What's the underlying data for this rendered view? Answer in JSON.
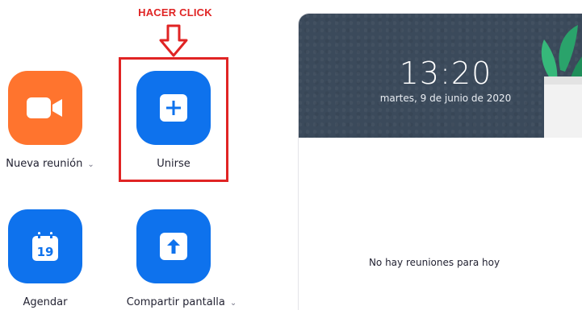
{
  "annotation": {
    "label": "HACER CLICK",
    "color": "#e02424"
  },
  "actions": {
    "new_meeting": {
      "label": "Nueva reunión",
      "color": "#ff742e",
      "icon": "video-camera-icon",
      "has_dropdown": true
    },
    "join": {
      "label": "Unirse",
      "color": "#0e72ed",
      "icon": "plus-icon"
    },
    "schedule": {
      "label": "Agendar",
      "color": "#0e72ed",
      "icon": "calendar-icon",
      "calendar_day": "19"
    },
    "share_screen": {
      "label": "Compartir pantalla",
      "color": "#0e72ed",
      "icon": "upload-arrow-icon",
      "has_dropdown": true
    }
  },
  "dropdown_glyph": "⌄",
  "header": {
    "time": "13:20",
    "date": "martes, 9 de junio de 2020",
    "background_color": "#3b4a5b"
  },
  "meetings": {
    "empty_message": "No hay reuniones para hoy"
  }
}
